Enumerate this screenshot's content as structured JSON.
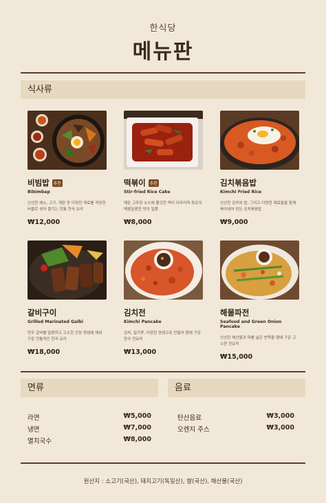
{
  "header": {
    "subtitle": "한식당",
    "title": "메뉴판"
  },
  "sections": {
    "main": "식사류",
    "noodles": "면류",
    "drinks": "음료"
  },
  "dishes": [
    {
      "name": "비빔밥",
      "badge": "추천",
      "en": "Bibimbap",
      "desc": "신선한 채소, 고기, 계란 등 다양한 재료를 적당한 비율로 섞어 즐기는 전통 한국 요리",
      "price": "₩12,000"
    },
    {
      "name": "떡볶이",
      "badge": "추천",
      "en": "Stir-fried Rice Cake",
      "desc": "매운 고추장 소스에 쫄깃한 떡이 어우러져 특유의 매콤달콤한 맛이 일품",
      "price": "₩8,000"
    },
    {
      "name": "김치볶음밥",
      "badge": "",
      "en": "Kimchi Fried Rice",
      "desc": "신선한 김치와 밥, 그리고 다양한 재료들을 함께 볶아내어 만든 김치볶음밥",
      "price": "₩9,000"
    },
    {
      "name": "갈비구이",
      "badge": "",
      "en": "Grilled Marinated Galbi",
      "desc": "한우 갈비를 달콤하고 고소한 간장 양념에 재워 구운 전통적인 한국 요리",
      "price": "₩18,000"
    },
    {
      "name": "김치전",
      "badge": "",
      "en": "Kimchi Pancake",
      "desc": "김치, 밀가루, 다양한 양념으로 만들어 팬에 구운 한국 전요리",
      "price": "₩13,000"
    },
    {
      "name": "해물파전",
      "badge": "",
      "en": "Seafood and Green Onion Pancake",
      "desc": "신선한 해산물과 파를 넓은 반죽물 팬에 구운 고소한 전요리",
      "price": "₩15,000"
    }
  ],
  "noodles": [
    {
      "name": "라면",
      "price": "₩5,000"
    },
    {
      "name": "냉면",
      "price": "₩7,000"
    },
    {
      "name": "멸치국수",
      "price": "₩8,000"
    }
  ],
  "drinks": [
    {
      "name": "탄산음료",
      "price": "₩3,000"
    },
    {
      "name": "오렌지 주스",
      "price": "₩3,000"
    }
  ],
  "footer": {
    "origin": "원산지 : 소고기(국산), 돼지고기(독일산), 쌀(국산), 해산물(국산)"
  }
}
